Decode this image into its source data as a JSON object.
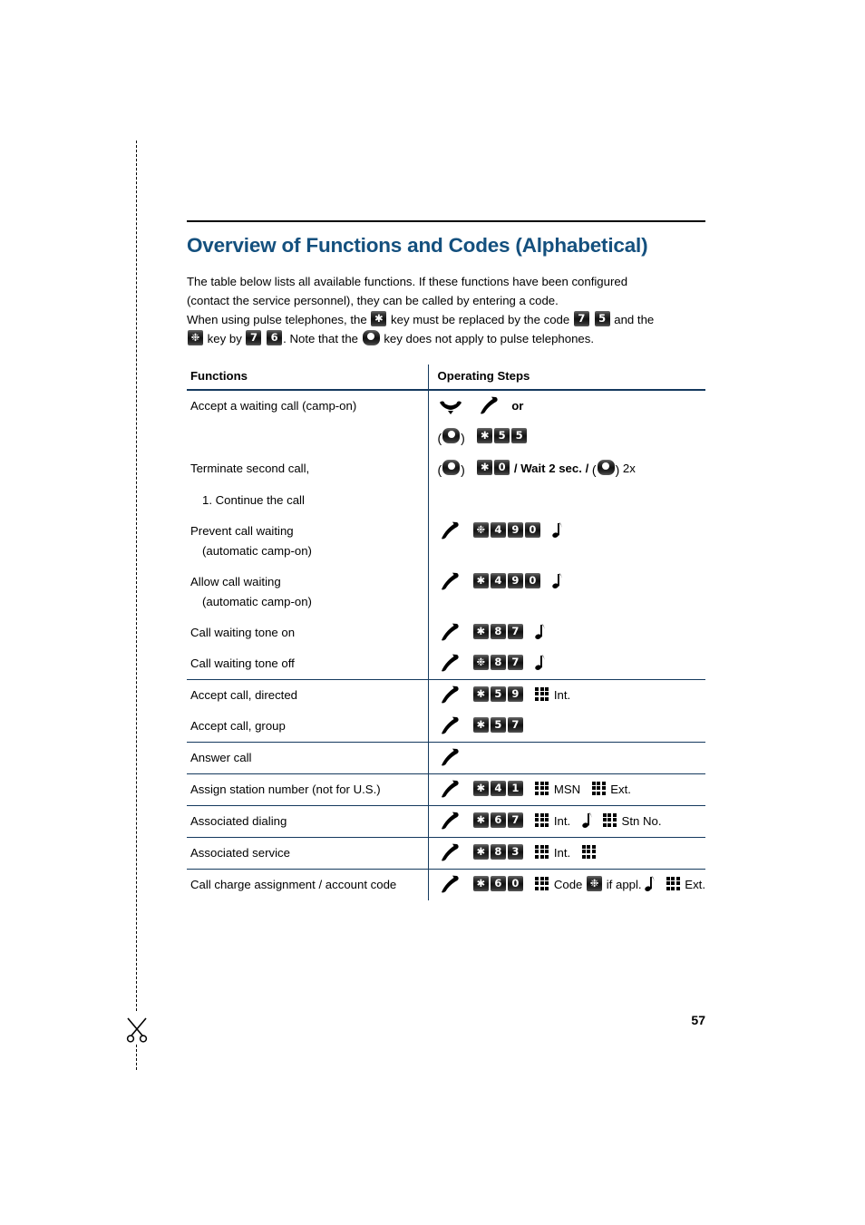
{
  "document": {
    "title": "Overview of Functions and Codes (Alphabetical)",
    "page_number": "57",
    "intro_line1": "The table below lists all available functions. If these functions have been configured",
    "intro_line2": "(contact the service personnel), they can be called by entering a code.",
    "intro_line3_a": "When using pulse telephones, the",
    "intro_line3_b": "key must be replaced by the code",
    "intro_line3_c": "and the",
    "intro_line4_a": "key by",
    "intro_line4_b": ". Note that the",
    "intro_line4_c": "key does not apply to pulse telephones.",
    "intro_keys": {
      "star": "✱",
      "hash": "❉",
      "code_7": "7",
      "code_5": "5",
      "code_7b": "7",
      "code_6": "6"
    }
  },
  "table": {
    "headers": {
      "functions": "Functions",
      "operating_steps": "Operating Steps"
    },
    "rows": [
      {
        "function": "Accept a waiting call (camp-on)",
        "function_sub": "",
        "steps_text": "or",
        "group_top": false
      },
      {
        "function": "",
        "function_sub": "",
        "steps_text": "",
        "keys": [
          "✱",
          "5",
          "5"
        ],
        "group_top": false
      },
      {
        "function": "Terminate second call,",
        "function_sub": "1. Continue the call",
        "steps_text_1": "/",
        "steps_text_2": "Wait 2 sec.",
        "steps_text_3": "/",
        "steps_text_4": "2x",
        "keys": [
          "✱",
          "0"
        ],
        "group_top": false
      },
      {
        "function": "Prevent call waiting",
        "function_sub": "(automatic camp-on)",
        "keys": [
          "❉",
          "4",
          "9",
          "0"
        ],
        "group_top": false
      },
      {
        "function": "Allow call waiting",
        "function_sub": "(automatic camp-on)",
        "keys": [
          "✱",
          "4",
          "9",
          "0"
        ],
        "group_top": false
      },
      {
        "function": "Call waiting tone on",
        "function_sub": "",
        "keys": [
          "✱",
          "8",
          "7"
        ],
        "group_top": false
      },
      {
        "function": "Call waiting tone off",
        "function_sub": "",
        "keys": [
          "❉",
          "8",
          "7"
        ],
        "group_top": false
      },
      {
        "function": "Accept call, directed",
        "function_sub": "",
        "keys": [
          "✱",
          "5",
          "9"
        ],
        "steps_text": "Int.",
        "group_top": true
      },
      {
        "function": "Accept call, group",
        "function_sub": "",
        "keys": [
          "✱",
          "5",
          "7"
        ],
        "group_top": false
      },
      {
        "function": "Answer call",
        "function_sub": "",
        "keys": [],
        "group_top": true
      },
      {
        "function": "Assign station number (not for U.S.)",
        "function_sub": "",
        "keys": [
          "✱",
          "4",
          "1"
        ],
        "steps_text_1": "MSN",
        "steps_text_2": "Ext.",
        "group_top": true
      },
      {
        "function": "Associated dialing",
        "function_sub": "",
        "keys": [
          "✱",
          "6",
          "7"
        ],
        "steps_text_1": "Int.",
        "steps_text_2": "Stn No.",
        "group_top": true
      },
      {
        "function": "Associated service",
        "function_sub": "",
        "keys": [
          "✱",
          "8",
          "3"
        ],
        "steps_text_1": "Int.",
        "group_top": true
      },
      {
        "function": "Call charge assignment / account code",
        "function_sub": "",
        "keys": [
          "✱",
          "6",
          "0"
        ],
        "steps_text_1": "Code",
        "steps_text_2": "if appl.",
        "steps_text_3": "Ext.",
        "group_top": true
      }
    ]
  },
  "colors": {
    "title": "#14507e",
    "rule": "#14395e",
    "key_dark": "#111111"
  }
}
